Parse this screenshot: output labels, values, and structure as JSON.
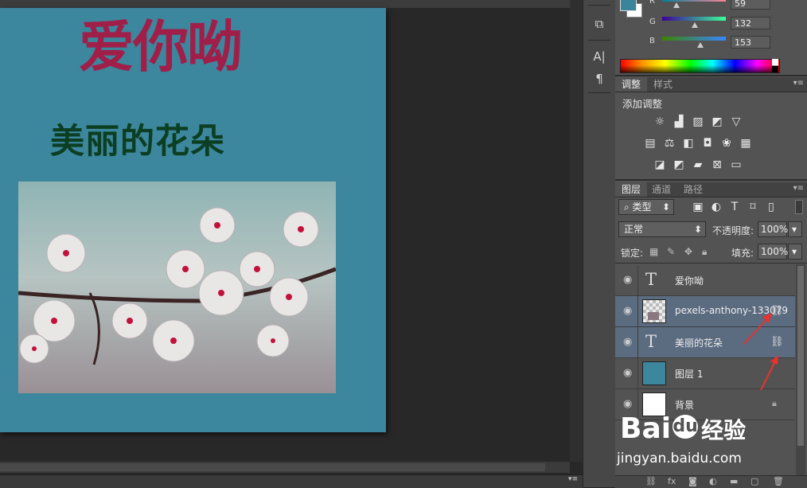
{
  "document": {
    "text_top": "爱你呦",
    "text_middle": "美丽的花朵"
  },
  "color_panel": {
    "foreground_color": "#3b8499",
    "channels": [
      {
        "label": "R",
        "value": "59"
      },
      {
        "label": "G",
        "value": "132"
      },
      {
        "label": "B",
        "value": "153"
      }
    ]
  },
  "adjustments_panel": {
    "tabs": [
      "调整",
      "样式"
    ],
    "title": "添加调整"
  },
  "layers_panel": {
    "tabs": [
      "图层",
      "通道",
      "路径"
    ],
    "filter_kind": "类型",
    "blend_mode": "正常",
    "opacity_label": "不透明度:",
    "opacity_value": "100%",
    "lock_label": "锁定:",
    "fill_label": "填充:",
    "fill_value": "100%",
    "layers": [
      {
        "name": "爱你呦",
        "kind": "text",
        "linked": false,
        "selected": false
      },
      {
        "name": "pexels-anthony-133079",
        "kind": "image",
        "linked": true,
        "selected": true
      },
      {
        "name": "美丽的花朵",
        "kind": "text",
        "linked": true,
        "selected": true
      },
      {
        "name": "图层 1",
        "kind": "fill",
        "linked": false,
        "selected": false
      },
      {
        "name": "背景",
        "kind": "background",
        "linked": false,
        "selected": false
      }
    ]
  },
  "watermark": {
    "brand": "Bai",
    "brand_product": "经验",
    "url": "jingyan.baidu.com"
  },
  "colors": {
    "canvas_bg": "#3c869e",
    "title_red": "#a01f49",
    "subtitle_green": "#0c3f22",
    "annotation_arrow": "#e8322c"
  }
}
